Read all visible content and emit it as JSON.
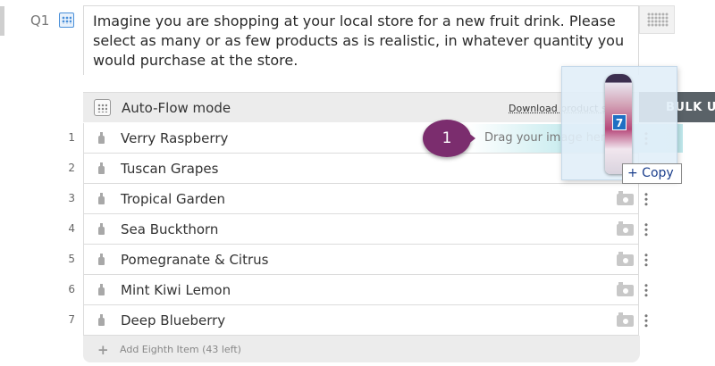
{
  "question": {
    "label": "Q1",
    "icon": "grid-icon",
    "text": "Imagine you are shopping at your local store for a new fruit drink. Please select as many or as few products as is realistic, in whatever quantity you would purchase at the store."
  },
  "toolbar": {
    "autoflow_label": "Auto-Flow mode",
    "download_label": "Download product s",
    "bulk_label": "BULK U"
  },
  "items": [
    {
      "num": "1",
      "label": "Verry Raspberry"
    },
    {
      "num": "2",
      "label": "Tuscan Grapes"
    },
    {
      "num": "3",
      "label": "Tropical Garden"
    },
    {
      "num": "4",
      "label": "Sea Buckthorn"
    },
    {
      "num": "5",
      "label": "Pomegranate & Citrus"
    },
    {
      "num": "6",
      "label": "Mint Kiwi Lemon"
    },
    {
      "num": "7",
      "label": "Deep Blueberry"
    }
  ],
  "drop_hint": "Drag your image here",
  "step_badge": "1",
  "drag_preview": {
    "product_number": "7",
    "copy_label": "+ Copy"
  },
  "add_item": {
    "label": "Add Eighth Item (43 left)"
  },
  "colors": {
    "badge": "#7b2d6e",
    "bulk_button": "#5a6268",
    "drop_highlight": "#bfe8ec"
  }
}
